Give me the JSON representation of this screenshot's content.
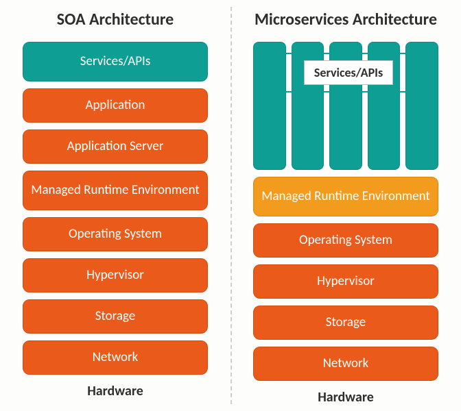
{
  "soa": {
    "title": "SOA Architecture",
    "layers": [
      {
        "label": "Services/APIs",
        "cls": "teal tall"
      },
      {
        "label": "Application",
        "cls": "orange"
      },
      {
        "label": "Application Server",
        "cls": "orange"
      },
      {
        "label": "Managed Runtime Environment",
        "cls": "orange tall"
      },
      {
        "label": "Operating System",
        "cls": "orange"
      },
      {
        "label": "Hypervisor",
        "cls": "orange"
      },
      {
        "label": "Storage",
        "cls": "orange"
      },
      {
        "label": "Network",
        "cls": "orange"
      }
    ],
    "footer": "Hardware"
  },
  "micro": {
    "title": "Microservices Architecture",
    "pillar_count": 5,
    "overlay_label": "Services/APIs",
    "layers": [
      {
        "label": "Managed Runtime Environment",
        "cls": "amber tall"
      },
      {
        "label": "Operating System",
        "cls": "orange"
      },
      {
        "label": "Hypervisor",
        "cls": "orange"
      },
      {
        "label": "Storage",
        "cls": "orange"
      },
      {
        "label": "Network",
        "cls": "orange"
      }
    ],
    "footer": "Hardware"
  }
}
